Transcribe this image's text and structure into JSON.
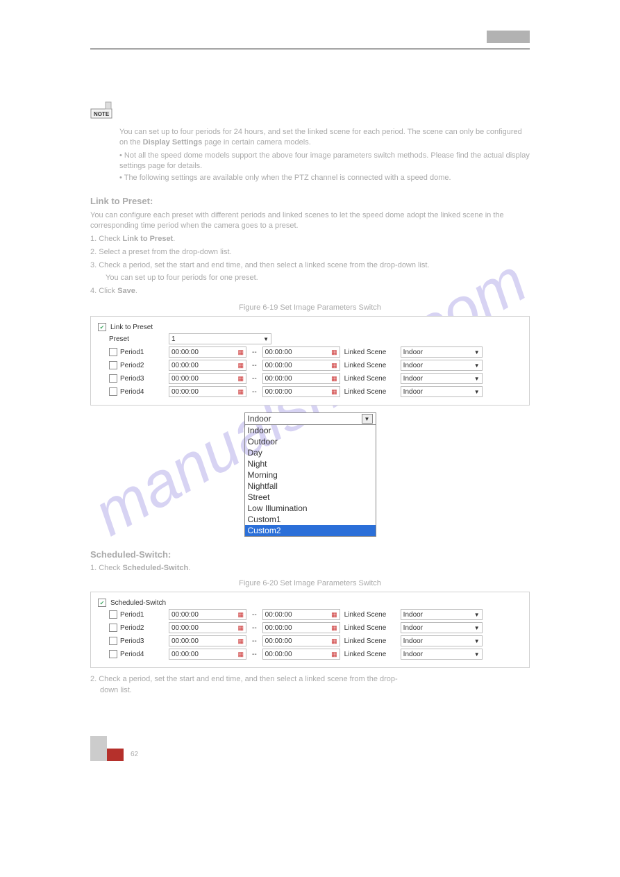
{
  "watermark": "manualshive.com",
  "noteParagraph": "You can set up to four periods for 24 hours, and set the linked scene for each period. The scene can only be configured on the",
  "noteBold": "Display Settings",
  "noteTail": " page in certain camera models.",
  "bullet1": "Not all the speed dome models support the above four image parameters switch methods. Please find the actual display settings page for details.",
  "bullet2": "The following settings are available only when the PTZ channel is connected with a speed dome.",
  "linkPresetTitle": "Link to Preset:",
  "linkPresetDesc": "You can configure each preset with different periods and linked scenes to let the speed dome adopt the linked scene in the corresponding time period when the camera goes to a preset.",
  "steps1_1": "1. Check",
  "steps1_1b": "Link to Preset",
  "steps1_1c": ".",
  "steps1_2": "2. Select a preset from the drop-down list.",
  "steps1_3": "3. Check a period, set the start and end time, and then select a linked scene from the drop-down list.",
  "stepSub1": "You can set up to four periods for one preset.",
  "steps1_4": "4. Click",
  "steps1_4b": "Save",
  "steps1_4c": ".",
  "fig1": "Figure 6-19 Set Image Parameters Switch",
  "panel1": {
    "linkLabel": "Link to Preset",
    "presetLabel": "Preset",
    "presetValue": "1",
    "rows": [
      {
        "p": "Period1",
        "t1": "00:00:00",
        "t2": "00:00:00",
        "ls": "Linked Scene",
        "scene": "Indoor"
      },
      {
        "p": "Period2",
        "t1": "00:00:00",
        "t2": "00:00:00",
        "ls": "Linked Scene",
        "scene": "Indoor"
      },
      {
        "p": "Period3",
        "t1": "00:00:00",
        "t2": "00:00:00",
        "ls": "Linked Scene",
        "scene": "Indoor"
      },
      {
        "p": "Period4",
        "t1": "00:00:00",
        "t2": "00:00:00",
        "ls": "Linked Scene",
        "scene": "Indoor"
      }
    ]
  },
  "dropdown": {
    "head": "Indoor",
    "items": [
      "Indoor",
      "Outdoor",
      "Day",
      "Night",
      "Morning",
      "Nightfall",
      "Street",
      "Low Illumination",
      "Custom1",
      "Custom2"
    ],
    "selected": "Custom2"
  },
  "scheduledTitle": "Scheduled-Switch:",
  "scheduledStep1a": "1. Check",
  "scheduledStep1b": "Scheduled-Switch",
  "scheduledStep1c": ".",
  "fig2": "Figure 6-20 Set Image Parameters Switch",
  "panel2": {
    "switchLabel": "Scheduled-Switch",
    "rows": [
      {
        "p": "Period1",
        "t1": "00:00:00",
        "t2": "00:00:00",
        "ls": "Linked Scene",
        "scene": "Indoor"
      },
      {
        "p": "Period2",
        "t1": "00:00:00",
        "t2": "00:00:00",
        "ls": "Linked Scene",
        "scene": "Indoor"
      },
      {
        "p": "Period3",
        "t1": "00:00:00",
        "t2": "00:00:00",
        "ls": "Linked Scene",
        "scene": "Indoor"
      },
      {
        "p": "Period4",
        "t1": "00:00:00",
        "t2": "00:00:00",
        "ls": "Linked Scene",
        "scene": "Indoor"
      }
    ]
  },
  "steps2_2": "2. Check a period, set the start and end time, and then select a linked scene from the drop-",
  "steps2_2b": "down list.",
  "pageNum": "62"
}
